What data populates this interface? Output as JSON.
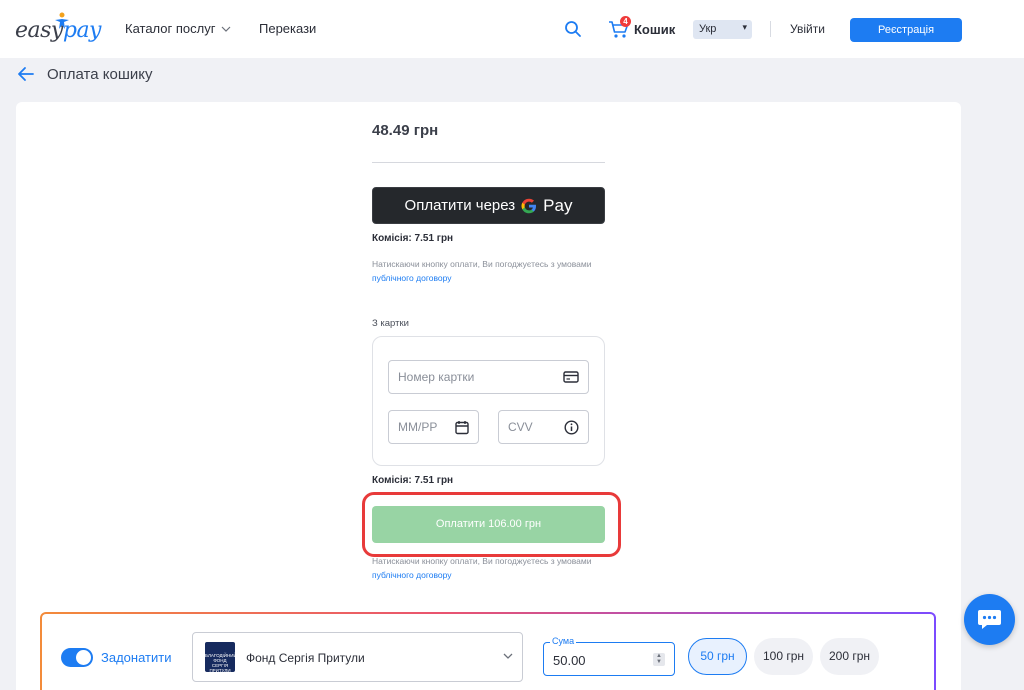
{
  "header": {
    "logo_left": "easy",
    "logo_right": "pay",
    "nav": {
      "catalog": "Каталог послуг",
      "transfers": "Перекази"
    },
    "cart": {
      "label": "Кошик",
      "count": "4"
    },
    "language": "Укр",
    "login": "Увійти",
    "register": "Реєстрація"
  },
  "page": {
    "title": "Оплата кошику"
  },
  "payment": {
    "amount": "48.49 грн",
    "gpay": {
      "label": "Оплатити через",
      "pay": "Pay"
    },
    "commission": "Комісія: 7.51 грн",
    "terms_text": "Натискаючи кнопку оплати, Ви погоджуєтесь з умовами",
    "terms_link": "публічного договору",
    "from_card": "З картки",
    "card_number_placeholder": "Номер картки",
    "expiry_placeholder": "ММ/РР",
    "cvv_placeholder": "CVV",
    "pay_button": "Оплатити 106.00 грн"
  },
  "donate": {
    "toggle_label": "Задонатити",
    "toggle_on": true,
    "fund_name": "Фонд Сергія Притули",
    "fund_logo_text": "БЛАГОДІЙНИЙ ФОНД СЕРГІЯ ПРИТУЛИ",
    "sum_label": "Сума",
    "sum_value": "50.00",
    "presets": [
      "50 грн",
      "100 грн",
      "200 грн"
    ]
  },
  "colors": {
    "accent": "#1d7cf2",
    "pay_button": "#98d4a4",
    "highlight": "#e83a3a",
    "badge": "#ef3b3b"
  }
}
